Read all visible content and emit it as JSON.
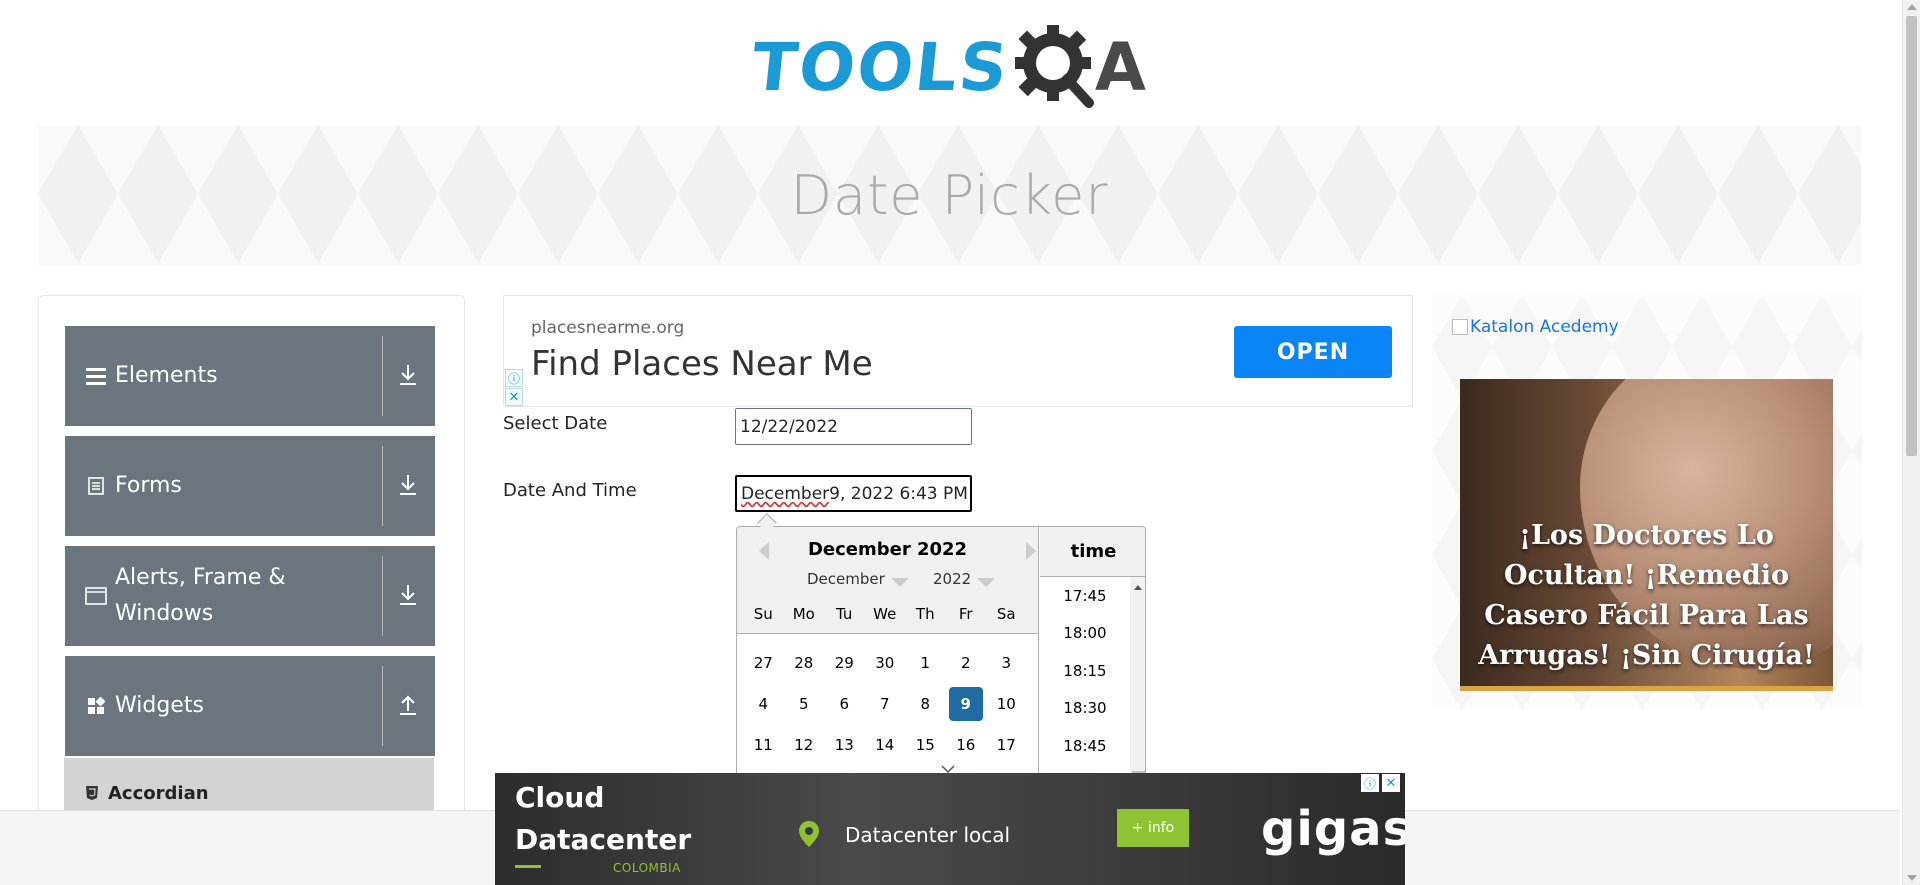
{
  "logo": {
    "text_main": "TOOLS",
    "text_end": "A",
    "colors": {
      "blue": "#1b9ad6",
      "dark": "#4a4a4a"
    }
  },
  "banner": {
    "title": "Date Picker"
  },
  "sidebar": {
    "groups": [
      {
        "label": "Elements",
        "icon": "hamburger-icon",
        "arrow": "download-arrow-icon"
      },
      {
        "label": "Forms",
        "icon": "document-icon",
        "arrow": "download-arrow-icon"
      },
      {
        "label": "Alerts, Frame &",
        "label2": "Windows",
        "icon": "window-icon",
        "arrow": "download-arrow-icon"
      },
      {
        "label": "Widgets",
        "icon": "grid-icon",
        "arrow": "upload-arrow-icon"
      }
    ],
    "active_item": {
      "label": "Accordian",
      "icon": "html5-icon"
    }
  },
  "ad_top": {
    "domain": "placesnearme.org",
    "headline": "Find Places Near Me",
    "button": "OPEN",
    "info": "ⓘ",
    "close": "✕",
    "accent": "#0a85f7"
  },
  "form": {
    "select_date": {
      "label": "Select Date",
      "value": "12/22/2022"
    },
    "date_time": {
      "label": "Date And Time",
      "value_part1": "December",
      "value_part2": " 9, 2022 6:43 PM"
    }
  },
  "calendar": {
    "title": "December 2022",
    "month_dropdown": "December",
    "year_dropdown": "2022",
    "weekdays": [
      "Su",
      "Mo",
      "Tu",
      "We",
      "Th",
      "Fr",
      "Sa"
    ],
    "weeks": [
      [
        "27",
        "28",
        "29",
        "30",
        "1",
        "2",
        "3"
      ],
      [
        "4",
        "5",
        "6",
        "7",
        "8",
        "9",
        "10"
      ],
      [
        "11",
        "12",
        "13",
        "14",
        "15",
        "16",
        "17"
      ]
    ],
    "selected_day": "9",
    "selected_color": "#216ba5",
    "time_header": "time",
    "times": [
      "17:45",
      "18:00",
      "18:15",
      "18:30",
      "18:45"
    ]
  },
  "ad_right": {
    "link_text": "Katalon Acedemy",
    "caption": "¡Los Doctores Lo Ocultan! ¡Remedio Casero Fácil Para Las Arrugas! ¡Sin Cirugía!"
  },
  "ad_bottom": {
    "title_line1": "Cloud",
    "title_line2": "Datacenter",
    "country": "COLOMBIA",
    "location": "Datacenter local",
    "button": "+ info",
    "brand": "gigas",
    "info": "ⓘ",
    "close": "✕",
    "accent": "#8ec431"
  }
}
